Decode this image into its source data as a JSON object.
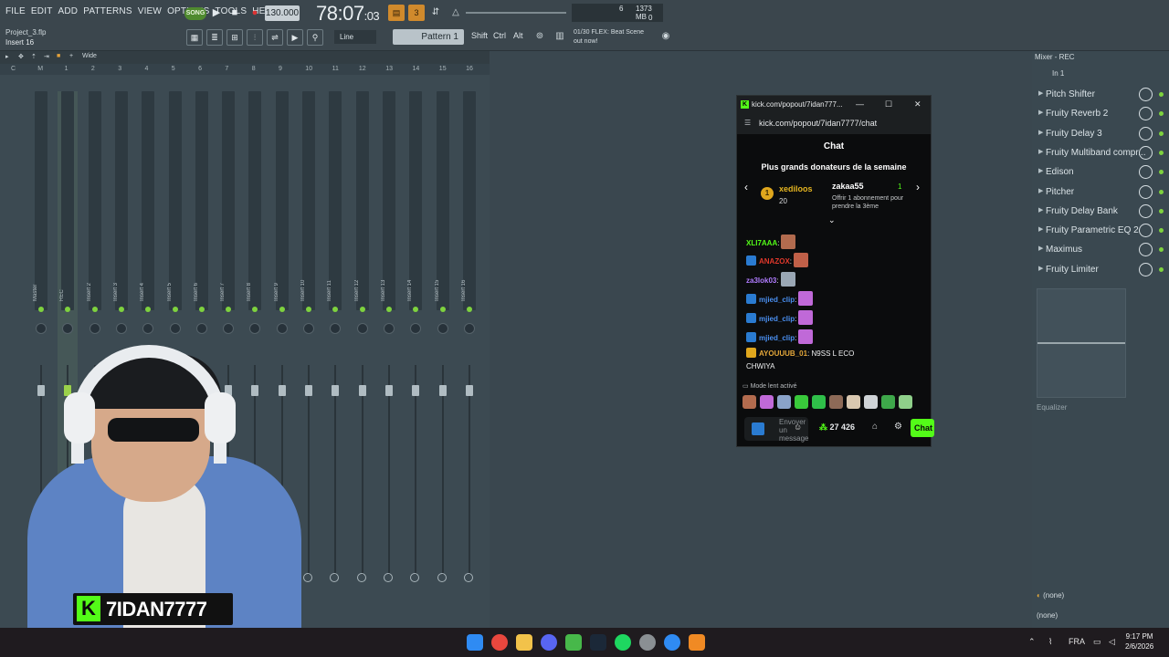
{
  "fl": {
    "menu": [
      "FILE",
      "EDIT",
      "ADD",
      "PATTERNS",
      "VIEW",
      "OPTIONS",
      "TOOLS",
      "HELP"
    ],
    "song_mode": "SONG",
    "tempo": "130.000",
    "time_main": "78:07",
    "time_sub": "03",
    "cpu": "1373 MB",
    "cpu_val": "6",
    "cpu_zero": "0",
    "project": "Project_3.flp",
    "insert": "Insert 16",
    "snap": "Line",
    "pattern": "Pattern 1",
    "keys": [
      "Shift",
      "Ctrl",
      "Alt"
    ],
    "hint_line1": "01/30  FLEX: Beat Scene",
    "hint_line2": "out now!",
    "mixer_view": "Wide",
    "ruler": [
      "C",
      "M",
      "1",
      "2",
      "3",
      "4",
      "5",
      "6",
      "7",
      "8",
      "9",
      "10",
      "11",
      "12",
      "13",
      "14",
      "15",
      "16"
    ],
    "tracks": [
      "Master",
      "REC",
      "Insert 2",
      "Insert 3",
      "Insert 4",
      "Insert 5",
      "Insert 6",
      "Insert 7",
      "Insert 8",
      "Insert 9",
      "Insert 10",
      "Insert 11",
      "Insert 12",
      "Insert 13",
      "Insert 14",
      "Insert 15",
      "Insert 16"
    ]
  },
  "mixer_panel": {
    "header": "Mixer - REC",
    "input": "In 1",
    "slots": [
      "Pitch Shifter",
      "Fruity Reverb 2",
      "Fruity Delay 3",
      "Fruity Multiband compr...",
      "Edison",
      "Pitcher",
      "Fruity Delay Bank",
      "Fruity Parametric EQ 2",
      "Maximus",
      "Fruity Limiter"
    ],
    "eq_label": "Equalizer",
    "none1": "(none)",
    "none2": "(none)"
  },
  "chat": {
    "window_title": "kick.com/popout/7idan777...",
    "url": "kick.com/popout/7idan7777/chat",
    "header": "Chat",
    "donors_title": "Plus grands donateurs de la semaine",
    "donor1_rank": "1",
    "donor1_name": "xediloos",
    "donor1_amount": "20",
    "donor2_name": "zakaa55",
    "donor2_amount": "1",
    "donor2_msg": "Offrir 1 abonnement pour prendre la 3ème",
    "messages": [
      {
        "user": "XLI7AAA",
        "text": ":"
      },
      {
        "user": "ANAZOX",
        "text": ":"
      },
      {
        "user": "za3lok03",
        "text": ":"
      },
      {
        "user": "mjied_clip",
        "text": ":"
      },
      {
        "user": "mjied_clip",
        "text": ":"
      },
      {
        "user": "mjied_clip",
        "text": ":"
      },
      {
        "user": "AYOUUUB_01",
        "text": ": N9SS L ECO"
      }
    ],
    "last_msg_cont": "CHWIYA",
    "slow_mode": "Mode lent activé",
    "input_placeholder": "Envoyer un message",
    "points": "27 426",
    "send_label": "Chat"
  },
  "streamer": {
    "name": "7IDAN7777",
    "logo": "K"
  },
  "taskbar": {
    "lang": "FRA",
    "time": "9:17 PM",
    "date": "2/6/2026"
  }
}
